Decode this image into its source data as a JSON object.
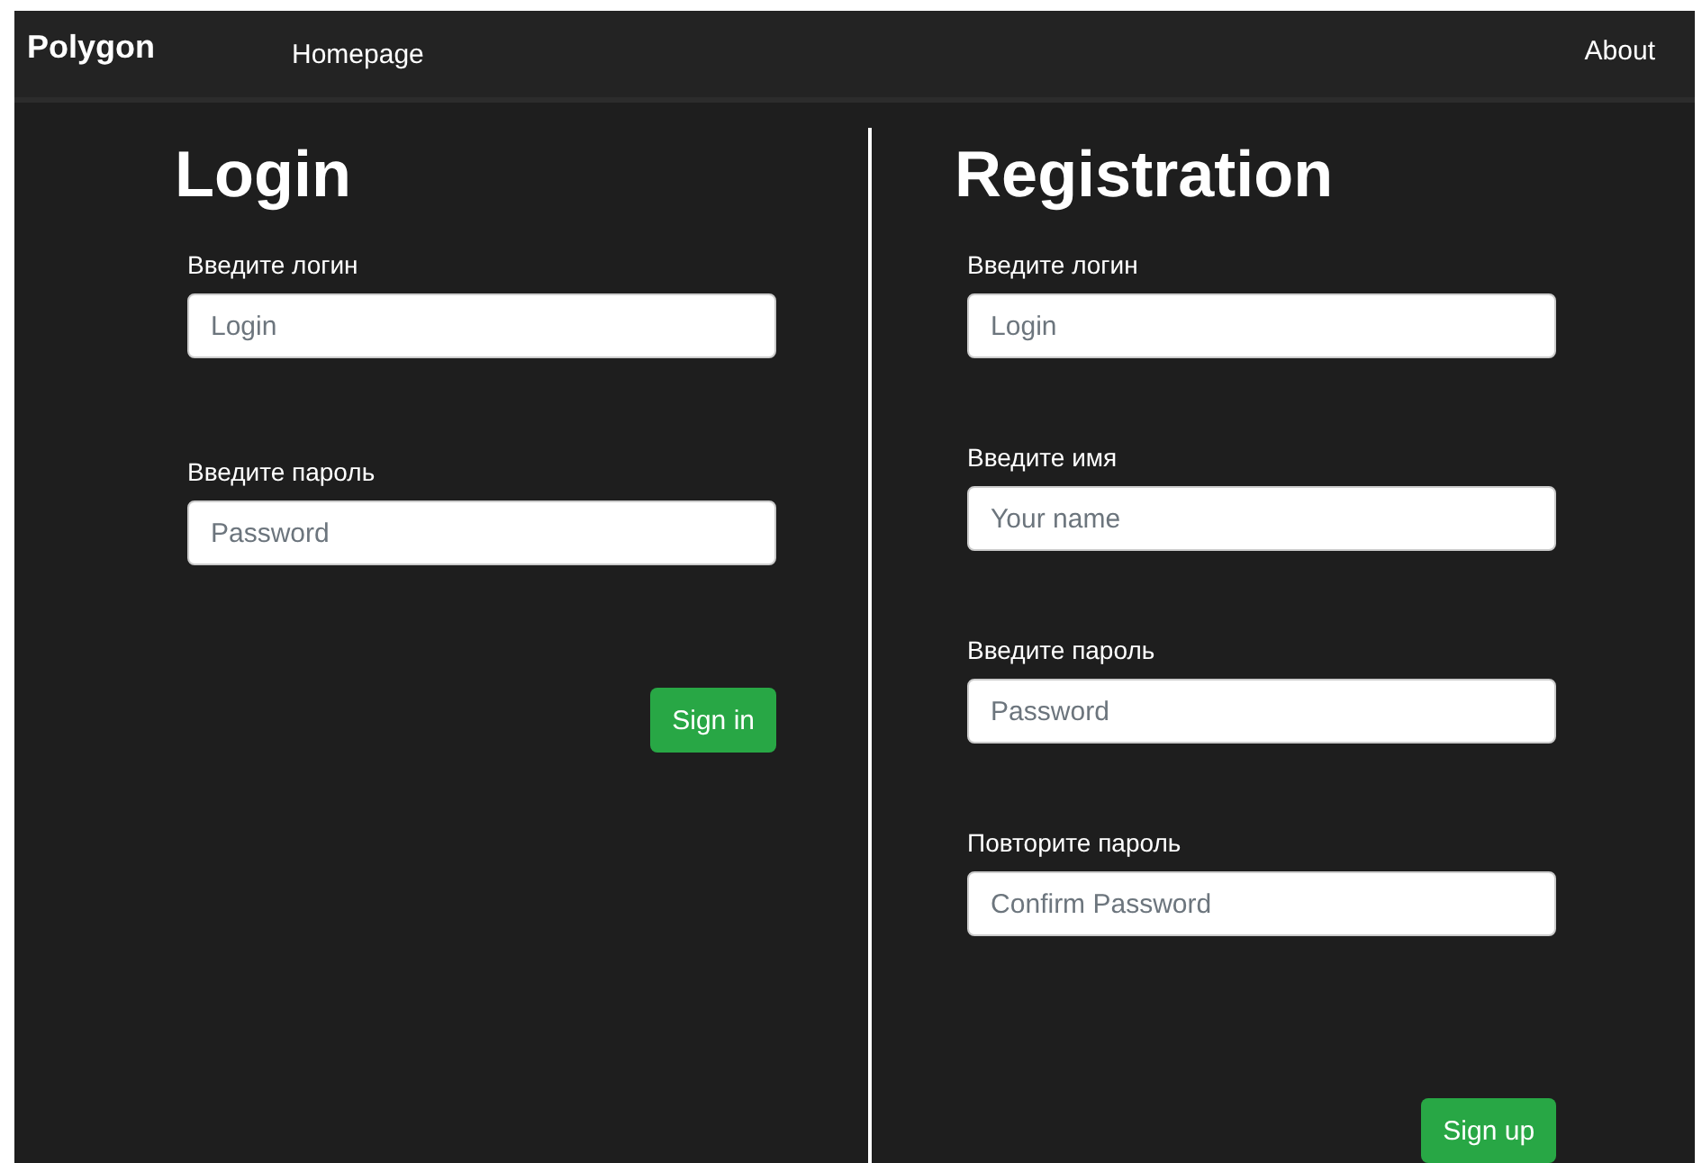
{
  "navbar": {
    "brand": "Polygon",
    "links": [
      {
        "label": "Homepage"
      },
      {
        "label": "About"
      }
    ]
  },
  "panels": [
    {
      "title": "Login",
      "fields": [
        {
          "label": "Введите логин",
          "placeholder": "Login"
        },
        {
          "label": "Введите пароль",
          "placeholder": "Password"
        }
      ],
      "button": "Sign in"
    },
    {
      "title": "Registration",
      "fields": [
        {
          "label": "Введите логин",
          "placeholder": "Login"
        },
        {
          "label": "Введите имя",
          "placeholder": "Your name"
        },
        {
          "label": "Введите пароль",
          "placeholder": "Password"
        },
        {
          "label": "Повторите пароль",
          "placeholder": "Confirm Password"
        }
      ],
      "button": "Sign up"
    }
  ]
}
